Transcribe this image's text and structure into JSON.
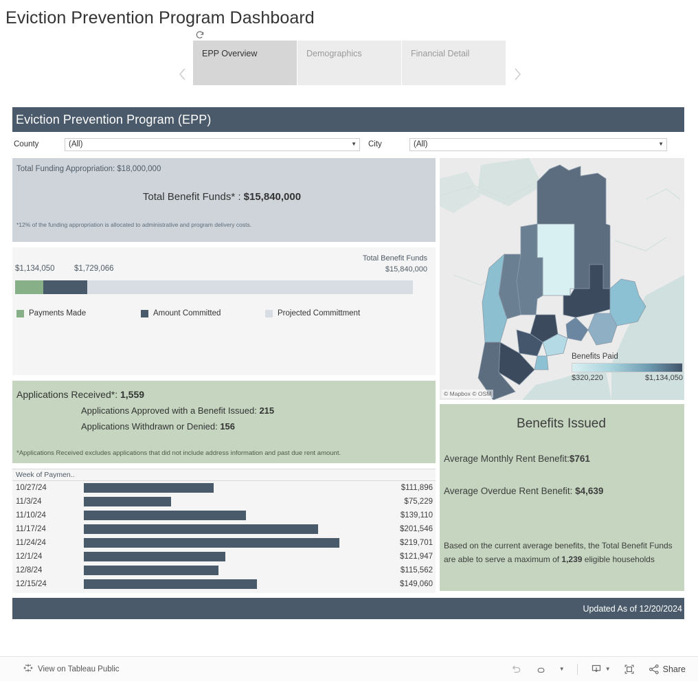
{
  "page": {
    "title": "Eviction Prevention Program Dashboard"
  },
  "tabs": {
    "refresh_icon": "refresh-icon",
    "prev_icon": "chevron-left-icon",
    "next_icon": "chevron-right-icon",
    "items": [
      {
        "label": "EPP Overview",
        "active": true
      },
      {
        "label": "Demographics",
        "active": false
      },
      {
        "label": "Financial Detail",
        "active": false
      }
    ]
  },
  "dashboard": {
    "header_title": "Eviction Prevention Program (EPP)",
    "updated_label": "Updated As of 12/20/2024"
  },
  "filters": {
    "county": {
      "label": "County",
      "value": "(All)",
      "caret_icon": "chevron-down-icon"
    },
    "city": {
      "label": "City",
      "value": "(All)",
      "caret_icon": "chevron-down-icon"
    }
  },
  "funding": {
    "appropriation_line": "Total Funding Appropriation: $18,000,000",
    "benefit_label": "Total Benefit Funds* : ",
    "benefit_value": "$15,840,000",
    "note": "*12% of the funding appropriation is allocated to administrative and program delivery costs."
  },
  "applications": {
    "received_label": "Applications Received*: ",
    "received_value": "1,559",
    "approved_label": "Applications Approved with a Benefit Issued: ",
    "approved_value": "215",
    "denied_label": "Applications Withdrawn or Denied: ",
    "denied_value": "156",
    "note": "*Applications Received excludes applications that did not include address information and past due rent amount."
  },
  "benefits": {
    "title": "Benefits Issued",
    "monthly_label": "Average Monthly Rent Benefit:",
    "monthly_value": "$761",
    "overdue_label": "Average Overdue Rent Benefit: ",
    "overdue_value": "$4,639",
    "note_pre": "Based on the current average benefits, the Total Benefit Funds are able to serve a maximum of ",
    "note_value": "1,239",
    "note_post": " eligible households"
  },
  "map": {
    "attribution": "© Mapbox  © OSM",
    "legend_title": "Benefits Paid",
    "legend_min": "$320,220",
    "legend_max": "$1,134,050"
  },
  "toolbar": {
    "view_label": "View on Tableau Public",
    "tableau_icon": "tableau-logo-icon",
    "undo_icon": "undo-icon",
    "redo_icon": "redo-icon",
    "revert_caret_icon": "chevron-down-icon",
    "download_icon": "download-icon",
    "download_caret_icon": "chevron-down-icon",
    "fullscreen_icon": "fullscreen-icon",
    "share_icon": "share-icon",
    "share_label": "Share"
  },
  "chart_data": [
    {
      "type": "bar",
      "orientation": "horizontal-stacked",
      "title": "Total Benefit Funds allocation",
      "total_label": "Total Benefit Funds",
      "total_value_label": "$15,840,000",
      "total_value": 15840000,
      "segment_labels": [
        "$1,134,050",
        "$1,729,066"
      ],
      "categories": [
        "Payments Made",
        "Amount Committed",
        "Projected Committment"
      ],
      "values": [
        1134050,
        1729066,
        12976884
      ],
      "colors": [
        "#87b088",
        "#495a6b",
        "#d8dce3"
      ],
      "legend": [
        "Payments Made",
        "Amount Committed",
        "Projected Committment"
      ],
      "legend_position": "bottom"
    },
    {
      "type": "bar",
      "orientation": "horizontal",
      "title": "Week of Paymen..",
      "xlabel": "",
      "ylabel": "Week of Paymen..",
      "color": "#495a6b",
      "categories": [
        "10/27/24",
        "11/3/24",
        "11/10/24",
        "11/17/24",
        "11/24/24",
        "12/1/24",
        "12/8/24",
        "12/15/24"
      ],
      "values": [
        111896,
        75229,
        139110,
        201546,
        219701,
        121947,
        115562,
        149060
      ],
      "value_labels": [
        "$111,896",
        "$75,229",
        "$139,110",
        "$201,546",
        "$219,701",
        "$121,947",
        "$115,562",
        "$149,060"
      ],
      "xlim": [
        0,
        219701
      ],
      "grid": false
    },
    {
      "type": "heatmap",
      "subtype": "choropleth-map",
      "title": "Benefits Paid",
      "region": "Maine counties",
      "legend_title": "Benefits Paid",
      "legend_min": 320220,
      "legend_max": 1134050,
      "legend_min_label": "$320,220",
      "legend_max_label": "$1,134,050",
      "colorscale": [
        "#d9f0f2",
        "#a8d3dd",
        "#6d9ab0",
        "#41556a"
      ]
    }
  ]
}
